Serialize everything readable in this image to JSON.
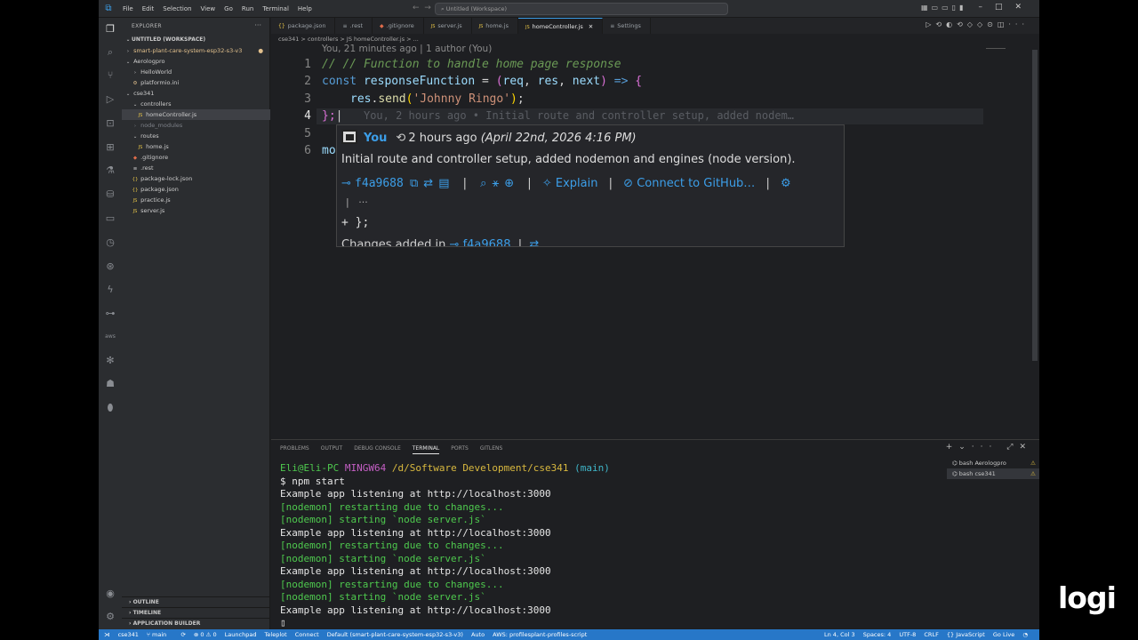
{
  "titlebar": {
    "menus": [
      "File",
      "Edit",
      "Selection",
      "View",
      "Go",
      "Run",
      "Terminal",
      "Help"
    ],
    "command_center": "Untitled (Workspace)"
  },
  "sidebar": {
    "title": "EXPLORER",
    "workspace": "UNTITLED (WORKSPACE)",
    "tree": [
      {
        "label": "smart-plant-care-system-esp32-s3-v3",
        "depth": 0,
        "kind": "folder-closed",
        "modified": true
      },
      {
        "label": "Aerologpro",
        "depth": 0,
        "kind": "folder-open"
      },
      {
        "label": "HelloWorld",
        "depth": 1,
        "kind": "folder-closed"
      },
      {
        "label": "platformio.ini",
        "depth": 1,
        "kind": "ini"
      },
      {
        "label": "cse341",
        "depth": 0,
        "kind": "folder-open"
      },
      {
        "label": "controllers",
        "depth": 1,
        "kind": "folder-open"
      },
      {
        "label": "homeController.js",
        "depth": 2,
        "kind": "js",
        "selected": true
      },
      {
        "label": "node_modules",
        "depth": 1,
        "kind": "folder-closed",
        "dim": true
      },
      {
        "label": "routes",
        "depth": 1,
        "kind": "folder-open"
      },
      {
        "label": "home.js",
        "depth": 2,
        "kind": "js"
      },
      {
        "label": ".gitignore",
        "depth": 1,
        "kind": "git"
      },
      {
        "label": ".rest",
        "depth": 1,
        "kind": "rest"
      },
      {
        "label": "package-lock.json",
        "depth": 1,
        "kind": "json"
      },
      {
        "label": "package.json",
        "depth": 1,
        "kind": "json"
      },
      {
        "label": "practice.js",
        "depth": 1,
        "kind": "js"
      },
      {
        "label": "server.js",
        "depth": 1,
        "kind": "js"
      }
    ],
    "bottom_sections": [
      "OUTLINE",
      "TIMELINE",
      "APPLICATION BUILDER"
    ]
  },
  "tabs": [
    {
      "label": "package.json",
      "icon": "{}"
    },
    {
      "label": ".rest",
      "icon": "≡"
    },
    {
      "label": ".gitignore",
      "icon": "◆"
    },
    {
      "label": "server.js",
      "icon": "JS"
    },
    {
      "label": "home.js",
      "icon": "JS"
    },
    {
      "label": "homeController.js",
      "icon": "JS",
      "active": true
    },
    {
      "label": "Settings",
      "icon": "≡"
    }
  ],
  "breadcrumb": "cse341 > controllers > JS homeController.js > ...",
  "codelens": "You, 21 minutes ago | 1 author (You)",
  "line_numbers": [
    "1",
    "2",
    "3",
    "4",
    "5",
    "6"
  ],
  "code": {
    "l1": "// // Function to handle home page response",
    "l2_kw": "const",
    "l2_fn": "responseFunction",
    "l2_eq": " = ",
    "l2_open": "(",
    "l2_p1": "req",
    "l2_p2": "res",
    "l2_p3": "next",
    "l2_close": ")",
    "l2_arrow": " => ",
    "l2_brace": "{",
    "l3_obj": "res",
    "l3_fn": "send",
    "l3_str": "'Johnny Ringo'",
    "l4": "};",
    "l4_blame": "You, 2 hours ago • Initial route and controller setup, added nodem…",
    "l6": "mo"
  },
  "hover": {
    "author": "You",
    "relative": "2 hours ago",
    "absolute": "(April 22nd, 2026 4:16 PM)",
    "message": "Initial route and controller setup, added nodemon and engines (node version).",
    "sha": "f4a9688",
    "explain": "Explain",
    "connect": "Connect to GitHub…",
    "more": "···",
    "diff": "+ };",
    "changes_label": "Changes added in",
    "changes_sha": "f4a9688"
  },
  "panel": {
    "tabs": [
      "PROBLEMS",
      "OUTPUT",
      "DEBUG CONSOLE",
      "TERMINAL",
      "PORTS",
      "GITLENS"
    ],
    "active_tab": "TERMINAL",
    "prompt_user": "Eli@Eli-PC",
    "prompt_sys": "MINGW64",
    "prompt_path": "/d/Software Development/cse341",
    "prompt_branch": "(main)",
    "command": "$ npm start",
    "lines": [
      {
        "text": "Example app listening at http://localhost:3000",
        "kind": "white"
      },
      {
        "text": "[nodemon] restarting due to changes...",
        "kind": "node"
      },
      {
        "text": "[nodemon] starting `node server.js`",
        "kind": "node"
      },
      {
        "text": "Example app listening at http://localhost:3000",
        "kind": "white"
      },
      {
        "text": "[nodemon] restarting due to changes...",
        "kind": "node"
      },
      {
        "text": "[nodemon] starting `node server.js`",
        "kind": "node"
      },
      {
        "text": "Example app listening at http://localhost:3000",
        "kind": "white"
      },
      {
        "text": "[nodemon] restarting due to changes...",
        "kind": "node"
      },
      {
        "text": "[nodemon] starting `node server.js`",
        "kind": "node"
      },
      {
        "text": "Example app listening at http://localhost:3000",
        "kind": "white"
      }
    ],
    "terminals": [
      {
        "label": "bash Aerologpro"
      },
      {
        "label": "bash cse341",
        "selected": true
      }
    ]
  },
  "status": {
    "left": [
      "cse341",
      "main",
      "⟳",
      "⊗ 0 ⚠ 0",
      "Launchpad",
      "Teleplot",
      "Connect",
      "Default (smart-plant-care-system-esp32-s3-v3)",
      "Auto",
      "AWS: profilesplant-profiles-script"
    ],
    "right": [
      "Ln 4, Col 3",
      "Spaces: 4",
      "UTF-8",
      "CRLF",
      "{} JavaScript",
      "Go Live"
    ]
  },
  "watermark": "logi",
  "colors": {
    "accent": "#3c9ee8",
    "statusbar": "#2777c8"
  }
}
